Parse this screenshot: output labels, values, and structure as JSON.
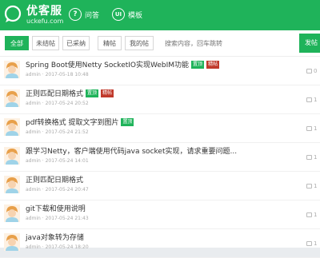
{
  "nav": {
    "brand": "优客服",
    "brand_url": "uckefu.com",
    "links": [
      {
        "label": "问答",
        "icon": "question-circle-icon"
      },
      {
        "label": "模板",
        "icon": "ui-badge-icon",
        "icon_text": "UI"
      }
    ]
  },
  "filters": {
    "tabs": [
      "全部",
      "未结帖",
      "已采纳",
      "精帖",
      "我的帖"
    ],
    "active_tab": 0,
    "search_placeholder": "搜索内容，回车跳转",
    "post_button": "发帖"
  },
  "posts": [
    {
      "title": "Spring Boot使用Netty SocketIO实现WebIM功能",
      "badges": [
        {
          "text": "置顶",
          "color": "green"
        },
        {
          "text": "精帖",
          "color": "red"
        }
      ],
      "author": "admin",
      "time": "2017-05-18 10:48",
      "comments": "0"
    },
    {
      "title": "正则匹配日期格式",
      "badges": [
        {
          "text": "置顶",
          "color": "green"
        },
        {
          "text": "精帖",
          "color": "red"
        }
      ],
      "author": "admin",
      "time": "2017-05-24 20:52",
      "comments": "1"
    },
    {
      "title": "pdf转换格式 提取文字到图片",
      "badges": [
        {
          "text": "置顶",
          "color": "green"
        }
      ],
      "author": "admin",
      "time": "2017-05-24 21:52",
      "comments": "1"
    },
    {
      "title": "跟学习Netty，客户端使用代码java socket实现，请求重要问题...",
      "badges": [],
      "author": "admin",
      "time": "2017-05-24 14:01",
      "comments": "1"
    },
    {
      "title": "正则匹配日期格式",
      "badges": [],
      "author": "admin",
      "time": "2017-05-24 20:47",
      "comments": "1"
    },
    {
      "title": "git下载和使用说明",
      "badges": [],
      "author": "admin",
      "time": "2017-05-24 21:43",
      "comments": "1"
    },
    {
      "title": "java对象转为存储",
      "badges": [],
      "author": "admin",
      "time": "2017-05-24 18:20",
      "comments": "1"
    }
  ],
  "colors": {
    "brand": "#1fb35a",
    "hot": "#c0392b"
  }
}
